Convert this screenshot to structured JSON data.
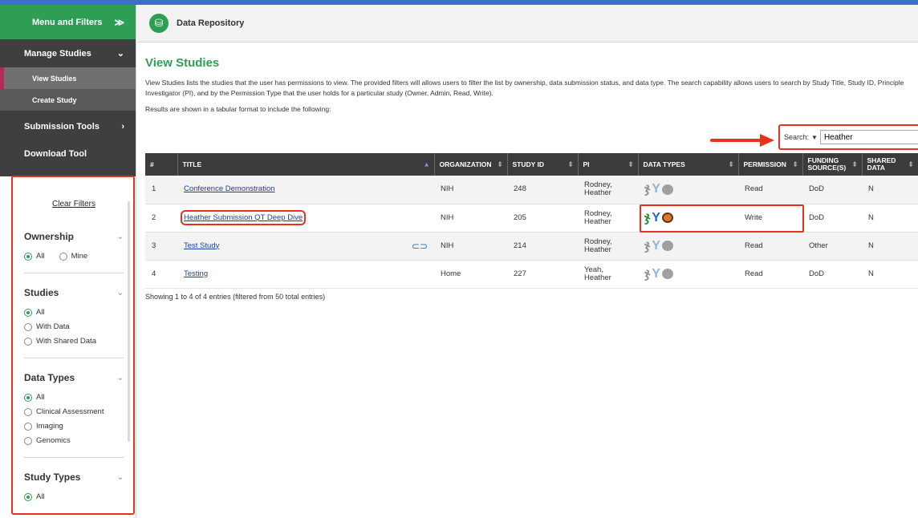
{
  "sidebar": {
    "header_label": "Menu and Filters",
    "manage_studies": "Manage Studies",
    "view_studies": "View Studies",
    "create_study": "Create Study",
    "submission_tools": "Submission Tools",
    "download_tool": "Download Tool"
  },
  "filters": {
    "clear": "Clear Filters",
    "ownership": {
      "title": "Ownership",
      "options": [
        "All",
        "Mine"
      ],
      "selected": "All"
    },
    "studies": {
      "title": "Studies",
      "options": [
        "All",
        "With Data",
        "With Shared Data"
      ],
      "selected": "All"
    },
    "data_types": {
      "title": "Data Types",
      "options": [
        "All",
        "Clinical Assessment",
        "Imaging",
        "Genomics"
      ],
      "selected": "All"
    },
    "study_types": {
      "title": "Study Types",
      "options": [
        "All"
      ],
      "selected": "All"
    }
  },
  "header": {
    "title": "Data Repository"
  },
  "main": {
    "title": "View Studies",
    "description": "View Studies lists the studies that the user has permissions to view. The provided filters will allows users to filter the list by ownership, data submission status, and data type. The search capability allows users to search by Study Title, Study ID, Principle Investigator (PI), and by the Permission Type that the user holds for a particular study (Owner, Admin, Read, Write).",
    "results_note": "Results are shown in a tabular format to include the following:",
    "footer": "Showing 1 to 4 of 4 entries (filtered from 50 total entries)"
  },
  "search": {
    "label": "Search:",
    "value": "Heather"
  },
  "table": {
    "headers": [
      "#",
      "TITLE",
      "ORGANIZATION",
      "STUDY ID",
      "PI",
      "DATA TYPES",
      "PERMISSION",
      "FUNDING SOURCE(S)",
      "SHARED DATA"
    ],
    "rows": [
      {
        "num": "1",
        "title": "Conference Demonstration",
        "org": "NIH",
        "id": "248",
        "pi": "Rodney, Heather",
        "permission": "Read",
        "funding": "DoD",
        "shared": "N",
        "data_active": false
      },
      {
        "num": "2",
        "title": "Heather Submission QT Deep Dive",
        "org": "NIH",
        "id": "205",
        "pi": "Rodney, Heather",
        "permission": "Write",
        "funding": "DoD",
        "shared": "N",
        "data_active": true
      },
      {
        "num": "3",
        "title": "Test Study",
        "org": "NIH",
        "id": "214",
        "pi": "Rodney, Heather",
        "permission": "Read",
        "funding": "Other",
        "shared": "N",
        "data_active": false
      },
      {
        "num": "4",
        "title": "Testing",
        "org": "Home",
        "id": "227",
        "pi": "Yeah, Heather",
        "permission": "Read",
        "funding": "DoD",
        "shared": "N",
        "data_active": false
      }
    ]
  },
  "icons": {
    "dna": "dna-icon",
    "imaging": "imaging-icon",
    "clinical": "brain-icon",
    "logo": "repository-logo-icon",
    "attachment": "paperclip-icon"
  },
  "colors": {
    "brand_green": "#2f9e55",
    "highlight_red": "#e5341c",
    "sidebar_dark": "#3f3f3f",
    "active_accent": "#b3285d"
  }
}
